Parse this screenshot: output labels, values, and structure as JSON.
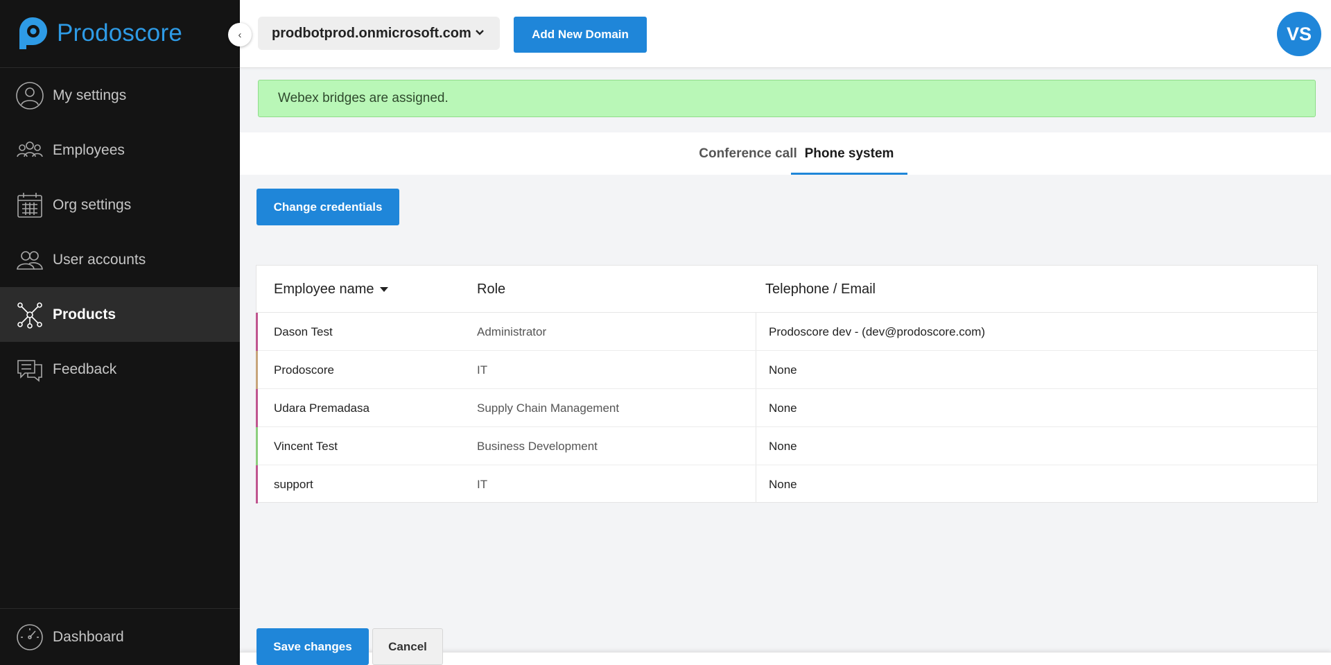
{
  "brand": {
    "name": "Prodoscore",
    "color": "#2e9be6"
  },
  "sidebar": {
    "items": [
      {
        "label": "My settings",
        "icon": "user-circle-icon",
        "active": false
      },
      {
        "label": "Employees",
        "icon": "employees-group-icon",
        "active": false
      },
      {
        "label": "Org settings",
        "icon": "calendar-icon",
        "active": false
      },
      {
        "label": "User accounts",
        "icon": "user-accounts-icon",
        "active": false
      },
      {
        "label": "Products",
        "icon": "products-network-icon",
        "active": true
      },
      {
        "label": "Feedback",
        "icon": "feedback-chat-icon",
        "active": false
      }
    ],
    "bottom_item": {
      "label": "Dashboard",
      "icon": "dashboard-gauge-icon"
    },
    "collapse_glyph": "‹"
  },
  "header": {
    "domain": "prodbotprod.onmicrosoft.com",
    "add_domain_label": "Add New Domain",
    "avatar_initials": "VS"
  },
  "alert": {
    "message": "Webex bridges are assigned.",
    "color": "#b9f7b7"
  },
  "tabs": [
    {
      "label": "Conference call",
      "active": false
    },
    {
      "label": "Phone system",
      "active": true
    }
  ],
  "actions": {
    "change_credentials_label": "Change credentials"
  },
  "table": {
    "columns": [
      "Employee name",
      "Role",
      "Telephone / Email"
    ],
    "rows": [
      {
        "name": "Dason Test",
        "role": "Administrator",
        "contact": "Prodoscore dev - (dev@prodoscore.com)",
        "bar_color": "#c0568f"
      },
      {
        "name": "Prodoscore",
        "role": "IT",
        "contact": "None",
        "bar_color": "#c7a57a"
      },
      {
        "name": "Udara Premadasa",
        "role": "Supply Chain Management",
        "contact": "None",
        "bar_color": "#c0568f"
      },
      {
        "name": "Vincent Test",
        "role": "Business Development",
        "contact": "None",
        "bar_color": "#8ccf7e"
      },
      {
        "name": "support",
        "role": "IT",
        "contact": "None",
        "bar_color": "#c0568f"
      }
    ]
  },
  "footer": {
    "save_label": "Save changes",
    "cancel_label": "Cancel"
  },
  "accent_color": "#1f86d9"
}
